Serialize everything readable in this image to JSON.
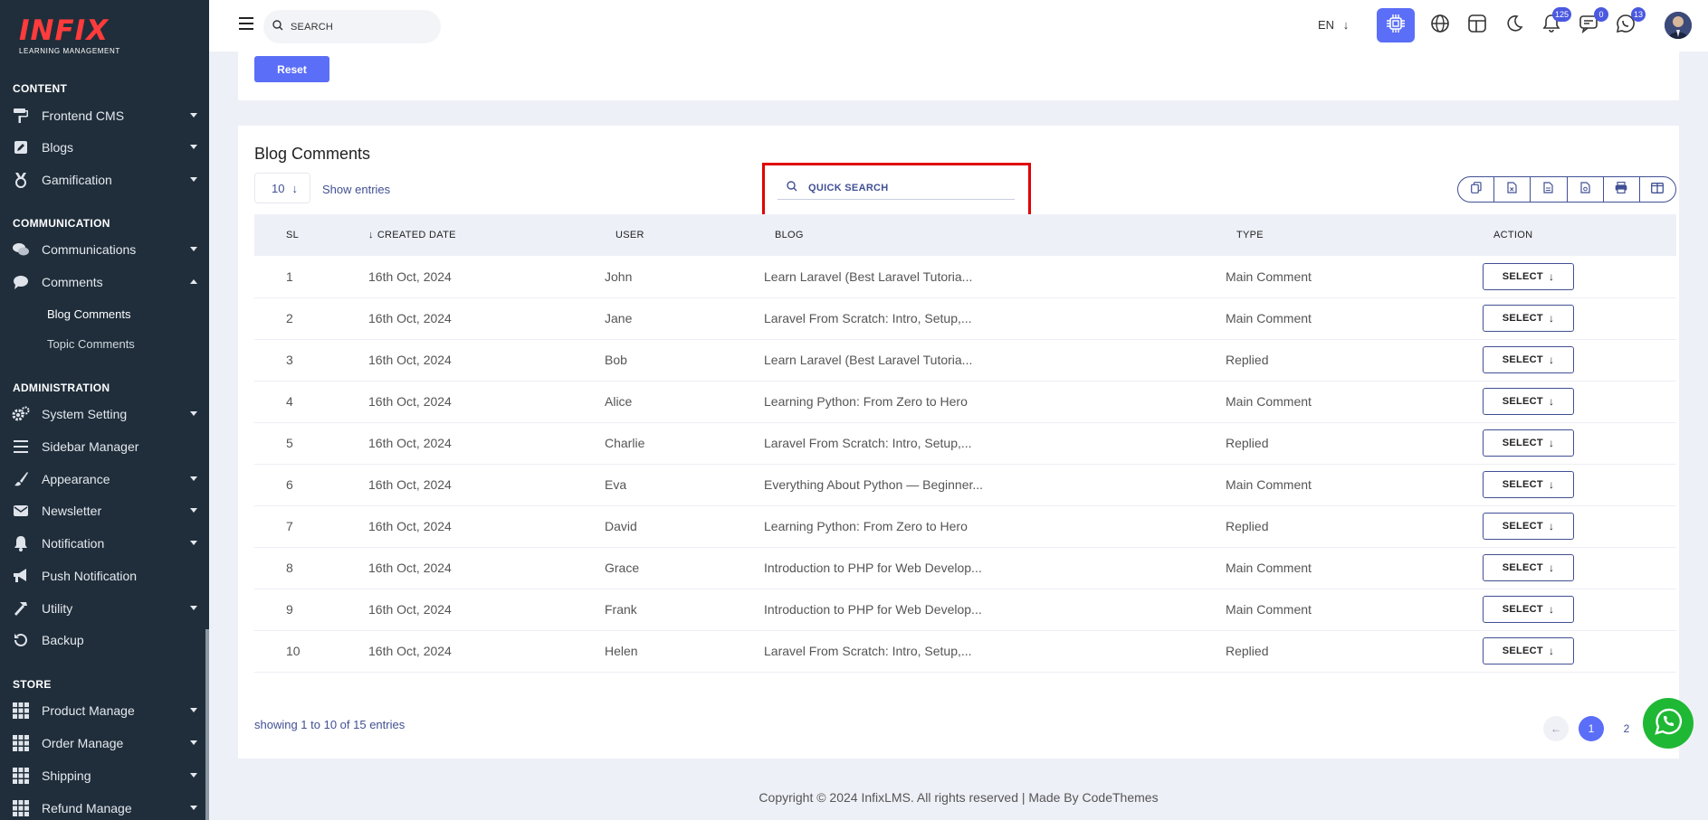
{
  "brand": {
    "name": "INFIX",
    "tagline": "LEARNING MANAGEMENT"
  },
  "topbar": {
    "search_label": "SEARCH",
    "language": "EN",
    "notifications_count": "125",
    "messages_count": "0",
    "whatsapp_count": "13"
  },
  "sidebar": {
    "sections": {
      "content": "CONTENT",
      "communication": "COMMUNICATION",
      "administration": "ADMINISTRATION",
      "store": "STORE"
    },
    "items": {
      "frontend_cms": "Frontend CMS",
      "blogs": "Blogs",
      "gamification": "Gamification",
      "communications": "Communications",
      "comments": "Comments",
      "blog_comments": "Blog Comments",
      "topic_comments": "Topic Comments",
      "system_setting": "System Setting",
      "sidebar_manager": "Sidebar Manager",
      "appearance": "Appearance",
      "newsletter": "Newsletter",
      "notification": "Notification",
      "push_notification": "Push Notification",
      "utility": "Utility",
      "backup": "Backup",
      "product_manage": "Product Manage",
      "order_manage": "Order Manage",
      "shipping": "Shipping",
      "refund_manage": "Refund Manage"
    }
  },
  "filter": {
    "reset_label": "Reset"
  },
  "main": {
    "title": "Blog Comments",
    "entries_value": "10",
    "entries_label": "Show entries",
    "quick_search_placeholder": "QUICK SEARCH",
    "columns": {
      "sl": "SL",
      "created": "CREATED DATE",
      "user": "USER",
      "blog": "BLOG",
      "type": "TYPE",
      "action": "ACTION"
    },
    "select_label": "SELECT",
    "rows": [
      {
        "sl": "1",
        "date": "16th Oct, 2024",
        "user": "John",
        "blog": "Learn Laravel (Best Laravel Tutoria...",
        "type": "Main Comment"
      },
      {
        "sl": "2",
        "date": "16th Oct, 2024",
        "user": "Jane",
        "blog": "Laravel From Scratch: Intro, Setup,...",
        "type": "Main Comment"
      },
      {
        "sl": "3",
        "date": "16th Oct, 2024",
        "user": "Bob",
        "blog": "Learn Laravel (Best Laravel Tutoria...",
        "type": "Replied"
      },
      {
        "sl": "4",
        "date": "16th Oct, 2024",
        "user": "Alice",
        "blog": "Learning Python: From Zero to Hero",
        "type": "Main Comment"
      },
      {
        "sl": "5",
        "date": "16th Oct, 2024",
        "user": "Charlie",
        "blog": "Laravel From Scratch: Intro, Setup,...",
        "type": "Replied"
      },
      {
        "sl": "6",
        "date": "16th Oct, 2024",
        "user": "Eva",
        "blog": "Everything About Python — Beginner...",
        "type": "Main Comment"
      },
      {
        "sl": "7",
        "date": "16th Oct, 2024",
        "user": "David",
        "blog": "Learning Python: From Zero to Hero",
        "type": "Replied"
      },
      {
        "sl": "8",
        "date": "16th Oct, 2024",
        "user": "Grace",
        "blog": "Introduction to PHP for Web Develop...",
        "type": "Main Comment"
      },
      {
        "sl": "9",
        "date": "16th Oct, 2024",
        "user": "Frank",
        "blog": "Introduction to PHP for Web Develop...",
        "type": "Main Comment"
      },
      {
        "sl": "10",
        "date": "16th Oct, 2024",
        "user": "Helen",
        "blog": "Laravel From Scratch: Intro, Setup,...",
        "type": "Replied"
      }
    ],
    "showing": "showing 1 to 10 of 15 entries",
    "pages": [
      "1",
      "2"
    ]
  },
  "footer": {
    "text": "Copyright © 2024 InfixLMS. All rights reserved | Made By CodeThemes"
  },
  "colors": {
    "sidebar_bg": "#202e3b",
    "accent": "#5b6ef7",
    "link": "#4b63e6",
    "highlight": "#e00000",
    "whatsapp": "#1fb834"
  }
}
